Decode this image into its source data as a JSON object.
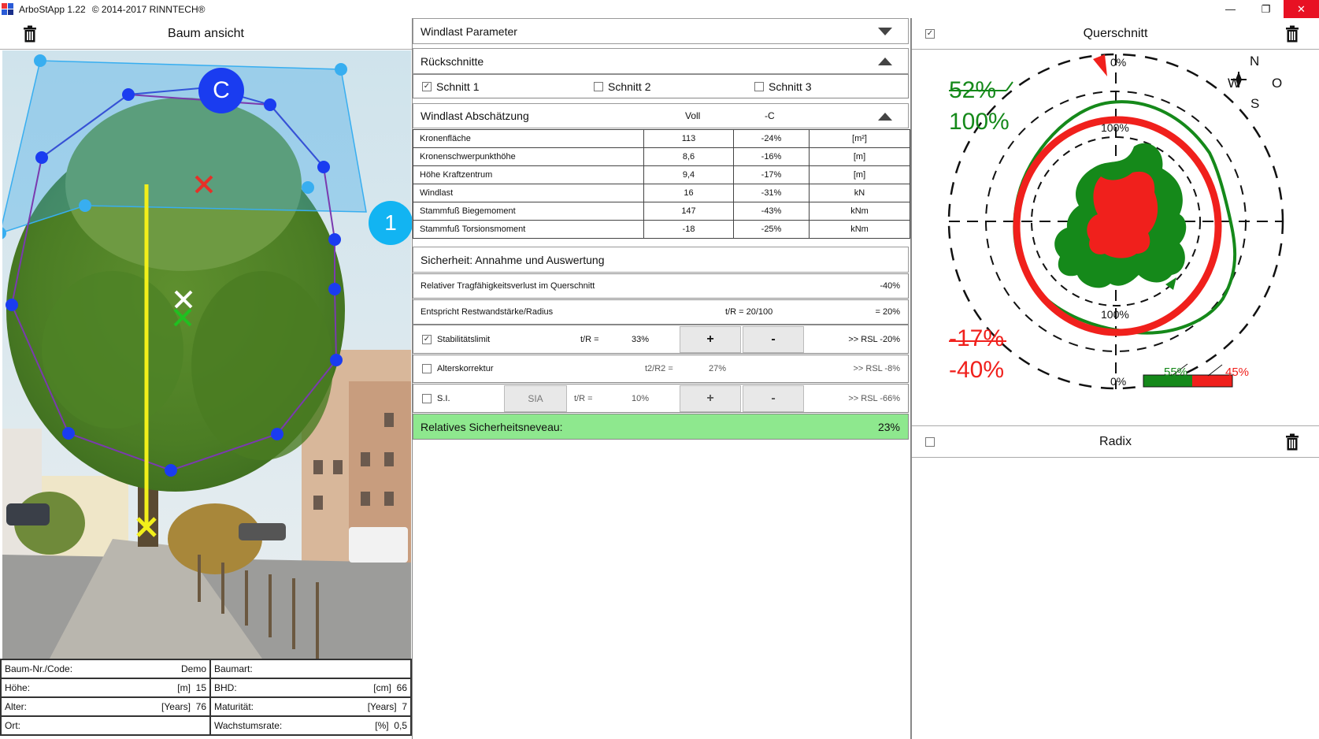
{
  "window": {
    "title": "ArboStApp 1.22",
    "copyright": "© 2014-2017 RINNTECH®",
    "minimize": "—",
    "restore": "❐",
    "close": "✕"
  },
  "left": {
    "title": "Baum ansicht",
    "markers": {
      "c": "C",
      "one": "1"
    },
    "info": [
      [
        {
          "label": "Baum-Nr./Code:",
          "value": "Demo"
        },
        {
          "label": "Baumart:",
          "value": ""
        }
      ],
      [
        {
          "label": "Höhe:",
          "unit": "[m]",
          "value": "15"
        },
        {
          "label": "BHD:",
          "unit": "[cm]",
          "value": "66"
        }
      ],
      [
        {
          "label": "Alter:",
          "unit": "[Years]",
          "value": "76"
        },
        {
          "label": "Maturität:",
          "unit": "[Years]",
          "value": "7"
        }
      ],
      [
        {
          "label": "Ort:",
          "value": ""
        },
        {
          "label": "Wachstumsrate:",
          "unit": "[%]",
          "value": "0,5"
        }
      ]
    ]
  },
  "middle": {
    "windlast_parameter": "Windlast Parameter",
    "rueckschnitte": {
      "title": "Rückschnitte",
      "items": [
        {
          "label": "Schnitt 1",
          "checked": true
        },
        {
          "label": "Schnitt 2",
          "checked": false
        },
        {
          "label": "Schnitt 3",
          "checked": false
        }
      ]
    },
    "abschaetzung": {
      "title": "Windlast Abschätzung",
      "col_voll": "Voll",
      "col_c": "-C",
      "rows": [
        [
          "Kronenfläche",
          "113",
          "-24%",
          "[m²]"
        ],
        [
          "Kronenschwerpunkthöhe",
          "8,6",
          "-16%",
          "[m]"
        ],
        [
          "Höhe Kraftzentrum",
          "9,4",
          "-17%",
          "[m]"
        ],
        [
          "Windlast",
          "16",
          "-31%",
          "kN"
        ],
        [
          "Stammfuß Biegemoment",
          "147",
          "-43%",
          "kNm"
        ],
        [
          "Stammfuß Torsionsmoment",
          "-18",
          "-25%",
          "kNm"
        ]
      ]
    },
    "sicherheit": {
      "title": "Sicherheit: Annahme und Auswertung",
      "rel_label": "Relativer Tragfähigkeitsverlust im Querschnitt",
      "rel_value": "-40%",
      "rest_label": "Entspricht Restwandstärke/Radius",
      "rest_mid": "t/R = 20/100",
      "rest_value": "= 20%",
      "stab_label": "Stabilitätslimit",
      "stab_tr": "t/R =",
      "stab_pct": "33%",
      "stab_result": ">> RSL -20%",
      "alter_label": "Alterskorrektur",
      "alter_tr": "t2/R2 =",
      "alter_pct": "27%",
      "alter_result": ">> RSL -8%",
      "si_label": "S.I.",
      "si_button": "SIA",
      "si_tr": "t/R =",
      "si_pct": "10%",
      "si_result": ">> RSL -66%",
      "plus": "+",
      "minus": "-",
      "niveau_label": "Relatives Sicherheitsneveau:",
      "niveau_value": "23%"
    }
  },
  "right": {
    "querschnitt": "Querschnitt",
    "radix": "Radix",
    "labels": {
      "top_green": "52%",
      "green_100": "100%",
      "red_17": "-17%",
      "red_40": "-40%",
      "zero_top": "0%",
      "zero_bottom": "0%",
      "hundred_top": "100%",
      "hundred_bottom": "100%",
      "bar_green": "55%",
      "bar_red": "45%",
      "compass_n": "N",
      "compass_w": "W",
      "compass_o": "O",
      "compass_s": "S"
    },
    "colors": {
      "green": "#1a8a1a",
      "red": "#e0201c",
      "niveau": "#8ee88e",
      "blue": "#1a3cf0"
    }
  }
}
